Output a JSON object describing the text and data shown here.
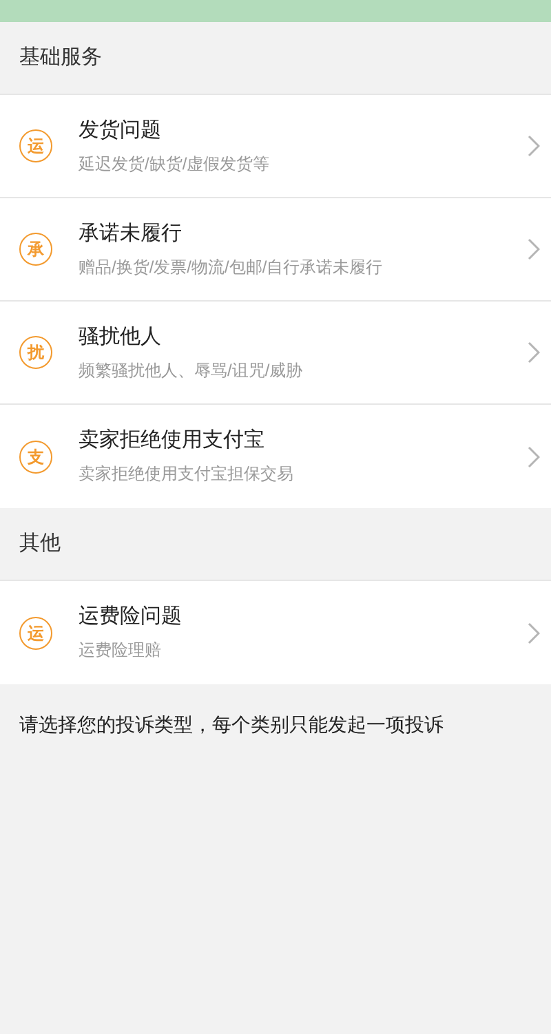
{
  "sections": [
    {
      "title": "基础服务",
      "items": [
        {
          "badge": "运",
          "title": "发货问题",
          "subtitle": "延迟发货/缺货/虚假发货等"
        },
        {
          "badge": "承",
          "title": "承诺未履行",
          "subtitle": "赠品/换货/发票/物流/包邮/自行承诺未履行"
        },
        {
          "badge": "扰",
          "title": "骚扰他人",
          "subtitle": "频繁骚扰他人、辱骂/诅咒/威胁"
        },
        {
          "badge": "支",
          "title": "卖家拒绝使用支付宝",
          "subtitle": "卖家拒绝使用支付宝担保交易"
        }
      ]
    },
    {
      "title": "其他",
      "items": [
        {
          "badge": "运",
          "title": "运费险问题",
          "subtitle": "运费险理赔"
        }
      ]
    }
  ],
  "note": "请选择您的投诉类型，每个类别只能发起一项投诉"
}
